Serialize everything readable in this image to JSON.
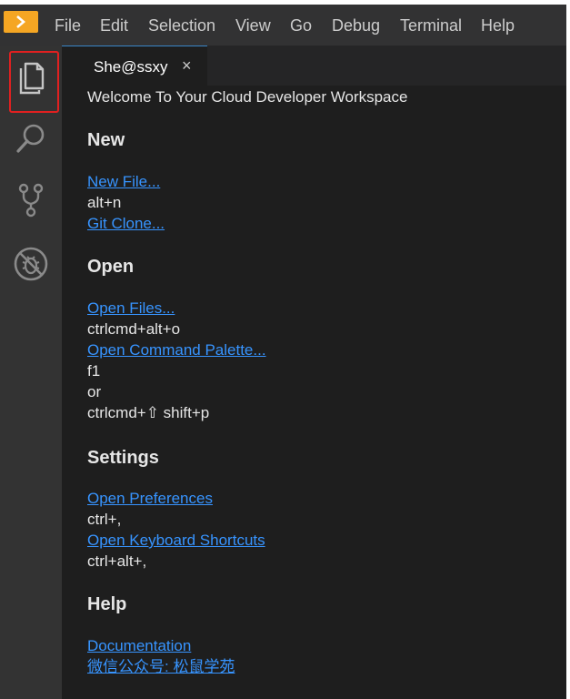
{
  "menubar": {
    "items": [
      "File",
      "Edit",
      "Selection",
      "View",
      "Go",
      "Debug",
      "Terminal",
      "Help"
    ]
  },
  "activitybar": {
    "icons": [
      "files-icon",
      "search-icon",
      "source-control-icon",
      "debug-icon"
    ]
  },
  "tab": {
    "label": "She@ssxy",
    "close": "×"
  },
  "welcome": {
    "title": "Welcome To Your Cloud Developer Workspace",
    "sections": {
      "new": {
        "heading": "New",
        "new_file": "New File...",
        "new_file_key": "alt+n",
        "git_clone": "Git Clone..."
      },
      "open": {
        "heading": "Open",
        "open_files": "Open Files...",
        "open_files_key": "ctrlcmd+alt+o",
        "command_palette": "Open Command Palette...",
        "command_palette_key1": "f1",
        "or": "or",
        "command_palette_key2": "ctrlcmd+⇧ shift+p"
      },
      "settings": {
        "heading": "Settings",
        "preferences": "Open Preferences",
        "preferences_key": "ctrl+,",
        "keyboard_shortcuts": "Open Keyboard Shortcuts",
        "keyboard_shortcuts_key": "ctrl+alt+,"
      },
      "help": {
        "heading": "Help",
        "documentation": "Documentation",
        "wechat": "微信公众号: 松鼠学苑"
      }
    }
  },
  "colors": {
    "menubar_bg": "#323233",
    "activitybar_bg": "#333333",
    "editor_bg": "#1e1e1e",
    "link": "#3794ff",
    "logo": "#f5a623",
    "highlight": "#e02020"
  }
}
